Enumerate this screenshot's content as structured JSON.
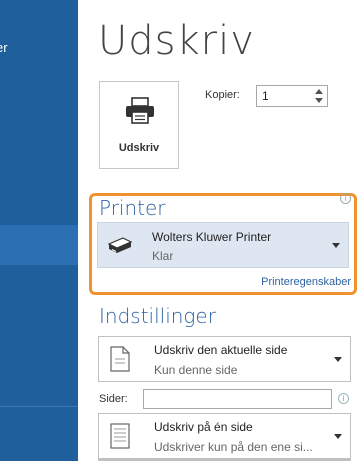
{
  "sidebar": {
    "partial_item_label": "er"
  },
  "main": {
    "title": "Udskriv",
    "print_button_label": "Udskriv",
    "copies": {
      "label": "Kopier:",
      "value": "1"
    }
  },
  "printer": {
    "section_title": "Printer",
    "name": "Wolters Kluwer Printer",
    "status": "Klar",
    "properties_link": "Printeregenskaber"
  },
  "settings": {
    "section_title": "Indstillinger",
    "print_range": {
      "title": "Udskriv den aktuelle side",
      "subtitle": "Kun denne side"
    },
    "pages": {
      "label": "Sider:",
      "value": ""
    },
    "sides": {
      "title": "Udskriv på én side",
      "subtitle": "Udskriver kun på den ene si..."
    }
  },
  "icons": {
    "print_button_icon": "printer-icon",
    "printer_device_icon": "printer-device-icon",
    "info_icon": "info-icon",
    "page_icon": "document-page-icon",
    "one_sided_icon": "one-sided-page-icon"
  },
  "colors": {
    "sidebar_bg": "#1f5f9c",
    "accent": "#2e62a1",
    "highlight_border": "#f0922e",
    "selected_printer_bg": "#dde6f1"
  }
}
